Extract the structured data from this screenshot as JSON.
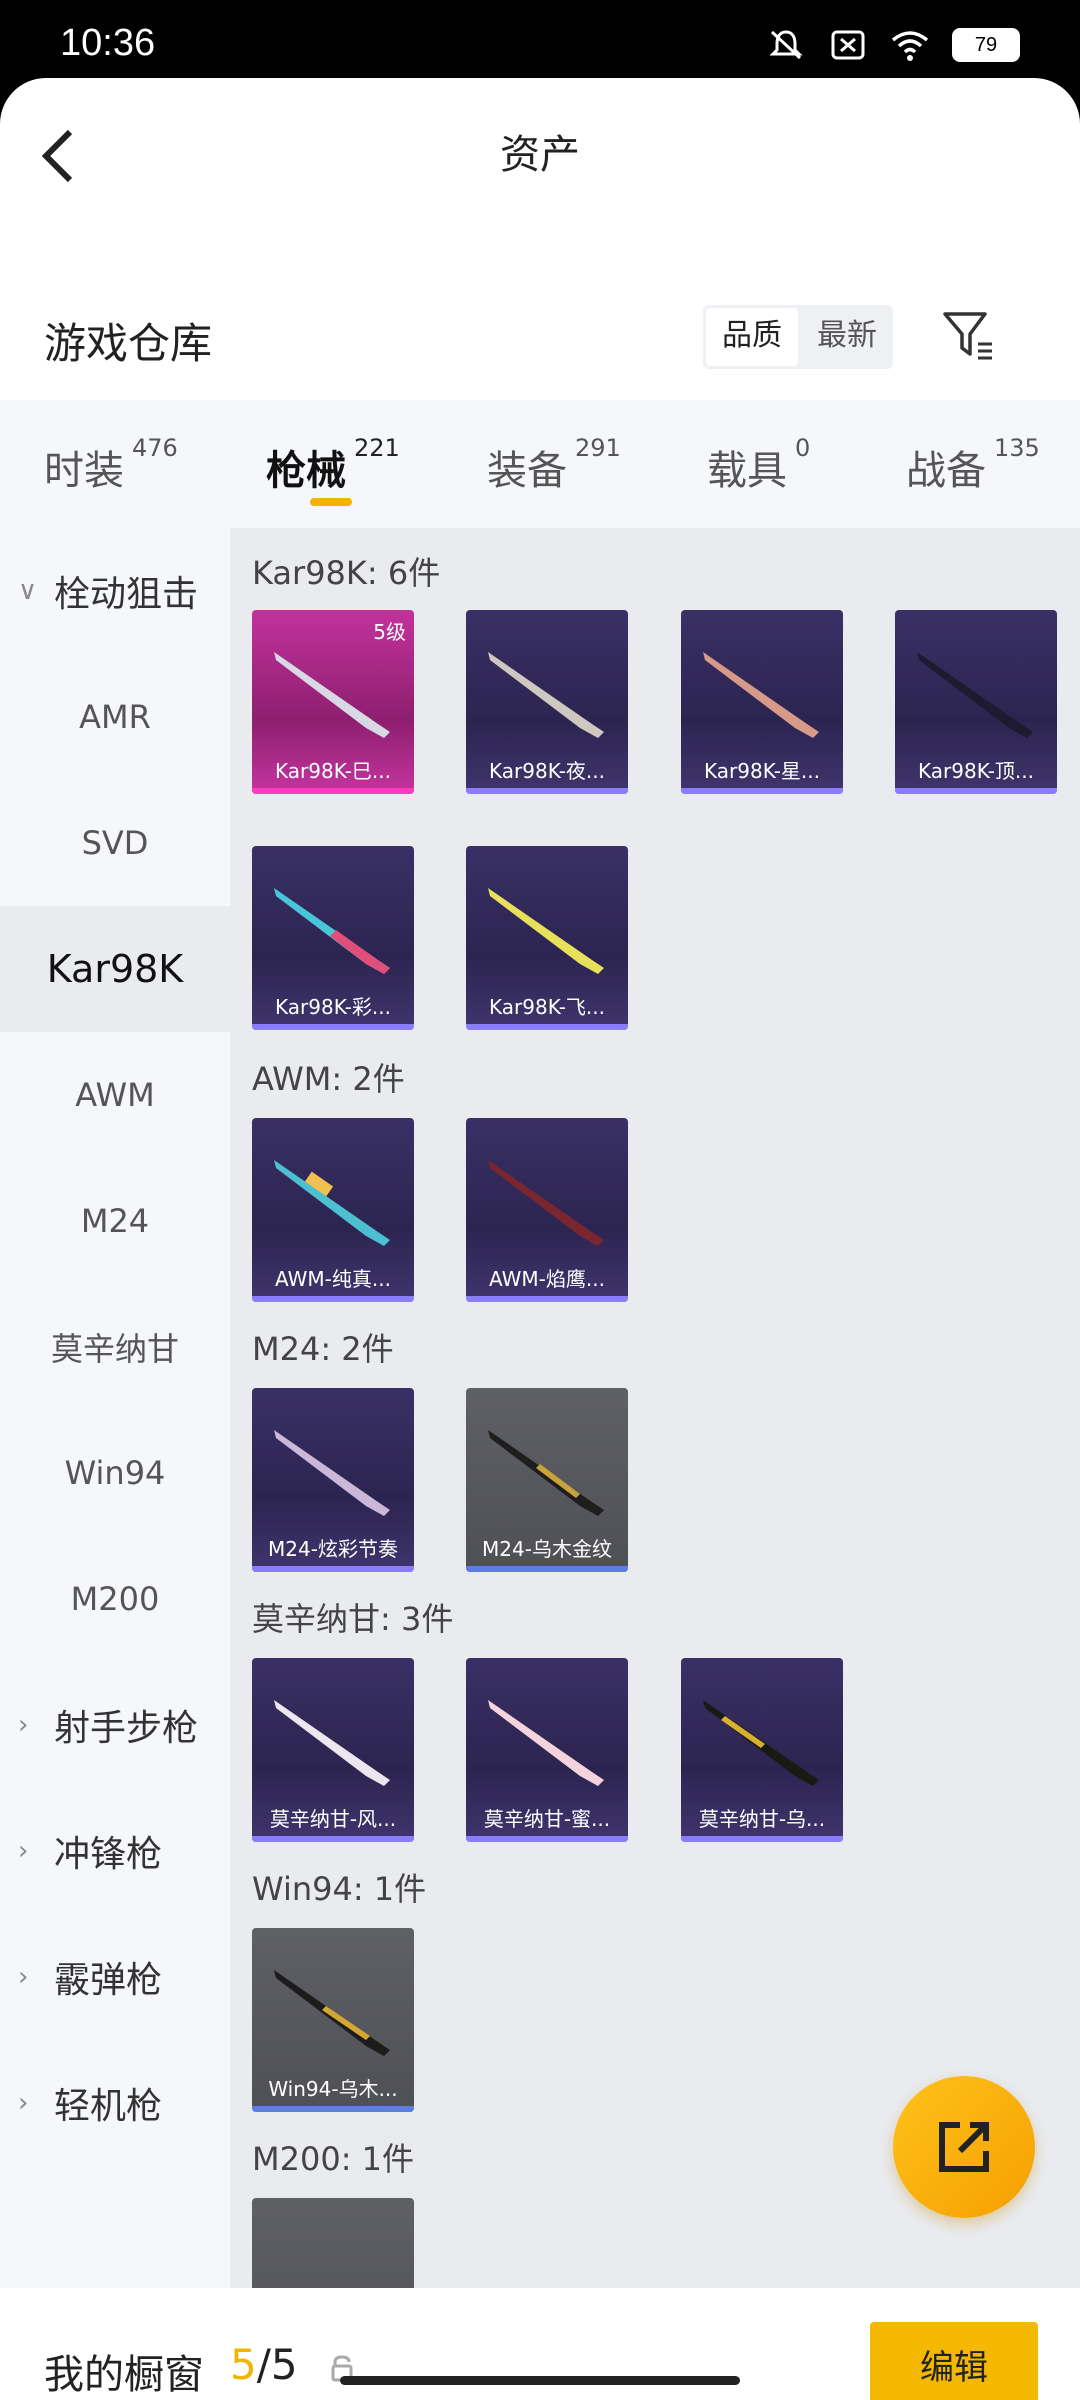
{
  "status": {
    "time": "10:36",
    "battery": "79"
  },
  "header": {
    "title": "资产"
  },
  "warehouse": {
    "title": "游戏仓库",
    "sort_quality": "品质",
    "sort_newest": "最新"
  },
  "tabs": [
    {
      "label": "时装",
      "count": "476"
    },
    {
      "label": "枪械",
      "count": "221"
    },
    {
      "label": "装备",
      "count": "291"
    },
    {
      "label": "载具",
      "count": "0"
    },
    {
      "label": "战备",
      "count": "135"
    }
  ],
  "sidebar": {
    "bolt_action": "栓动狙击",
    "items": [
      "AMR",
      "SVD",
      "Kar98K",
      "AWM",
      "M24",
      "莫辛纳甘",
      "Win94",
      "M200"
    ],
    "marksman": "射手步枪",
    "smg": "冲锋枪",
    "shotgun": "霰弹枪",
    "lmg": "轻机枪"
  },
  "groups": [
    {
      "title": "Kar98K: 6件",
      "items": [
        {
          "name": "Kar98K-巳...",
          "level": "5级"
        },
        {
          "name": "Kar98K-夜..."
        },
        {
          "name": "Kar98K-星..."
        },
        {
          "name": "Kar98K-顶..."
        },
        {
          "name": "Kar98K-彩..."
        },
        {
          "name": "Kar98K-飞..."
        }
      ]
    },
    {
      "title": "AWM: 2件",
      "items": [
        {
          "name": "AWM-纯真..."
        },
        {
          "name": "AWM-焰鹰..."
        }
      ]
    },
    {
      "title": "M24: 2件",
      "items": [
        {
          "name": "M24-炫彩节奏"
        },
        {
          "name": "M24-乌木金纹"
        }
      ]
    },
    {
      "title": "莫辛纳甘: 3件",
      "items": [
        {
          "name": "莫辛纳甘-风..."
        },
        {
          "name": "莫辛纳甘-蜜..."
        },
        {
          "name": "莫辛纳甘-乌..."
        }
      ]
    },
    {
      "title": "Win94: 1件",
      "items": [
        {
          "name": "Win94-乌木..."
        }
      ]
    },
    {
      "title": "M200: 1件",
      "items": []
    }
  ],
  "showcase": {
    "label": "我的橱窗",
    "current": "5",
    "total": "/5",
    "edit": "编辑"
  },
  "colors": {
    "accent": "#f5b800",
    "epic": "#8b7dff",
    "legendary": "#ff3bbd"
  }
}
